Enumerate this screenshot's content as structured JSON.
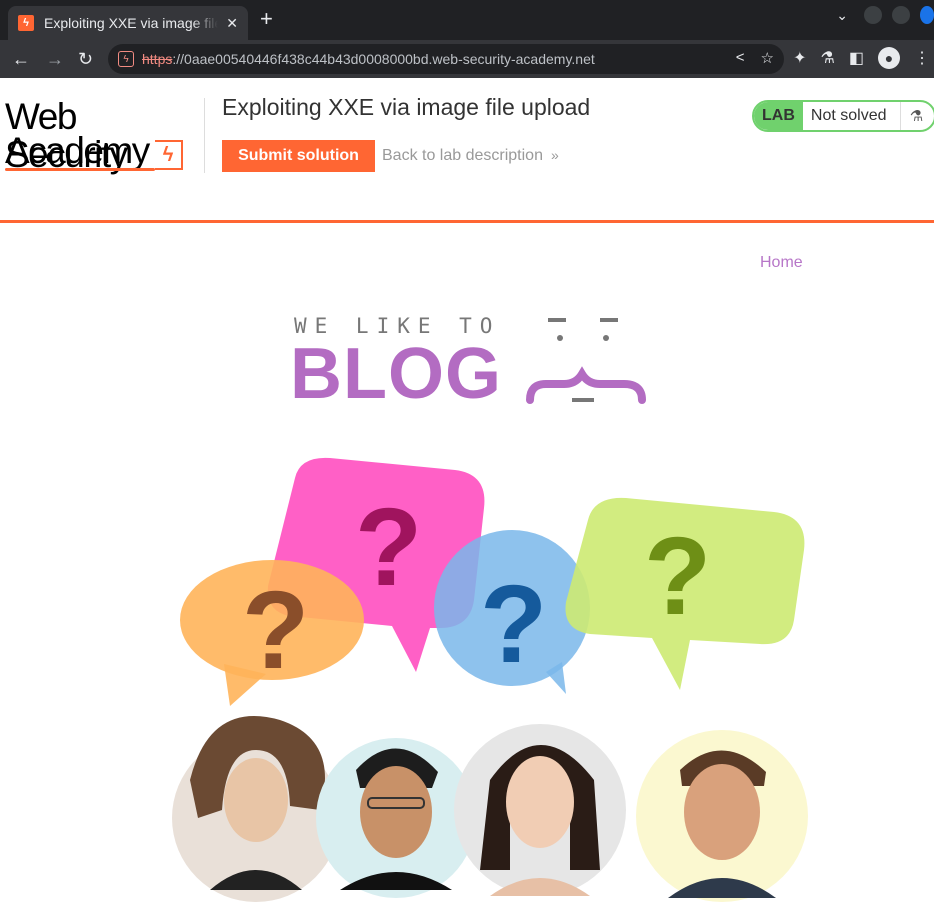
{
  "browser": {
    "tab_title": "Exploiting XXE via image file upload",
    "tab_close": "✕",
    "new_tab": "+",
    "url_scheme": "https",
    "url_rest": "://0aae00540446f438c44b43d0008000bd.web-security-academy.net"
  },
  "header": {
    "logo_line1": "Web Security",
    "logo_line2": "Academy",
    "lab_title": "Exploiting XXE via image file upload",
    "submit_label": "Submit solution",
    "back_label": "Back to lab description",
    "status_tag": "LAB",
    "status_text": "Not solved"
  },
  "nav": {
    "home": "Home"
  },
  "banner": {
    "tagline": "WE LIKE TO",
    "word": "BLOG"
  },
  "colors": {
    "accent": "#ff6633",
    "blog_purple": "#b36cc2",
    "status_green": "#70d16d"
  }
}
